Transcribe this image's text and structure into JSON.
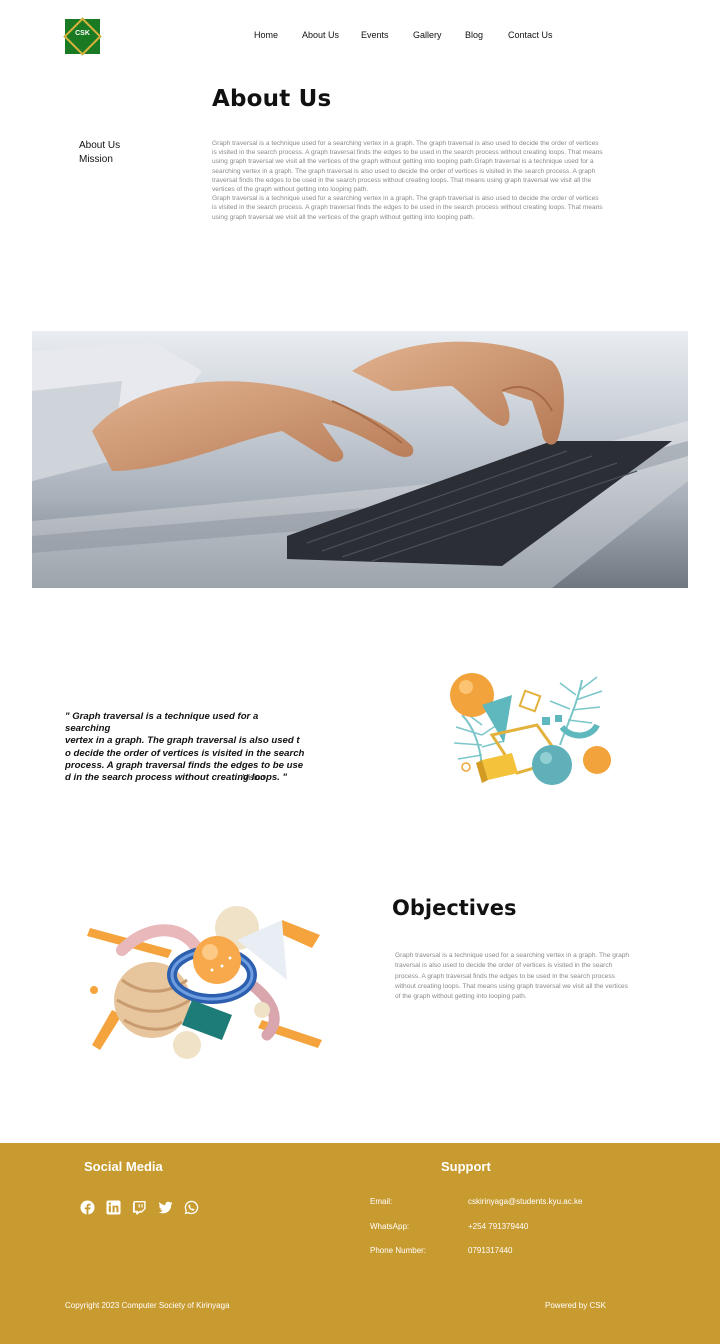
{
  "nav": {
    "logo_text": "CSK",
    "items": [
      "Home",
      "About Us",
      "Events",
      "Gallery",
      "Blog",
      "Contact Us"
    ]
  },
  "about": {
    "title": "About Us",
    "side_links": [
      "About Us",
      "Mission"
    ],
    "paragraph_1": "Graph traversal is a technique used for a searching vertex in a graph. The graph traversal is also used to decide the order of vertices is visited in the search process. A graph traversal finds the edges to be used in the search process without creating loops. That means using graph traversal we visit all the vertices of the graph without getting into looping path.Graph traversal is a technique used for a searching vertex in a graph. The graph traversal is also used to decide the order of vertices is visited in the search process. A graph traversal finds the edges to be used in the search process without creating loops. That means using graph traversal we visit all the vertices of the graph without getting into looping path.",
    "paragraph_2": "Graph traversal is a technique used for a searching vertex in a graph. The graph traversal is also used to decide the order of vertices is visited in the search process. A graph traversal finds the edges to be used in the search process without creating loops. That means using graph traversal we visit all the vertices of the graph without getting into looping path."
  },
  "vision": {
    "quote": "\" Graph traversal is a technique used for a searching\n vertex in a graph. The graph traversal is also used t\no decide the order of vertices is visited in the search\nprocess. A graph traversal finds the edges to be use\nd in the search process without creating loops. \"",
    "label": "Vision"
  },
  "objectives": {
    "title": "Objectives",
    "text": "Graph traversal is a technique used for a searching vertex in a graph. The graph traversal is also used to decide the order of vertices is visited in the search process. A graph traversal finds the edges to be used in the search process without creating loops. That means using graph traversal we visit all the vertices of the graph without getting into looping path."
  },
  "footer": {
    "social_title": "Social Media",
    "social_icons": [
      "facebook-icon",
      "linkedin-icon",
      "twitch-icon",
      "twitter-icon",
      "whatsapp-icon"
    ],
    "support_title": "Support",
    "email_label": "Email:",
    "email_value": "cskirinyaga@students.kyu.ac.ke",
    "whatsapp_label": "WhatsApp:",
    "whatsapp_value": "+254 791379440",
    "phone_label": "Phone Number:",
    "phone_value": "0791317440",
    "copyright": "Copyright   2023 Computer Society of Kirinyaga",
    "powered": "Powered by CSK"
  },
  "colors": {
    "footer_bg": "#c89b30",
    "logo_green": "#1a7a24",
    "logo_gold": "#d8b23a"
  }
}
